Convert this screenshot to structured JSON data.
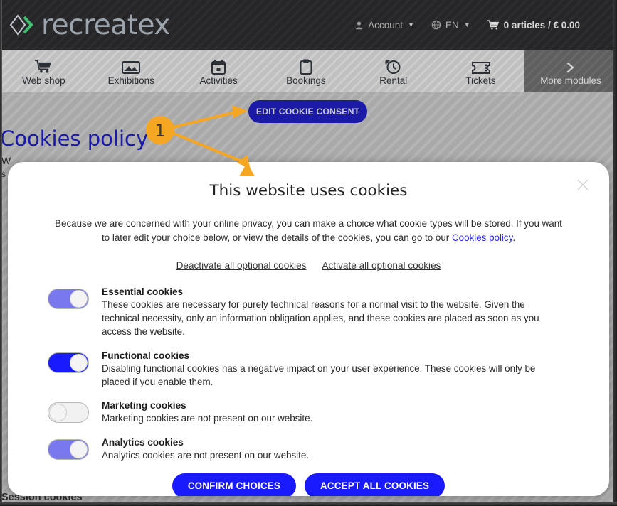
{
  "header": {
    "logo_text": "recreatex",
    "account_label": "Account",
    "language_label": "EN",
    "cart_label": "0 articles / € 0.00"
  },
  "nav": {
    "items": [
      {
        "label": "Web shop",
        "icon": "shopping-cart-icon"
      },
      {
        "label": "Exhibitions",
        "icon": "picture-icon"
      },
      {
        "label": "Activities",
        "icon": "calendar-icon"
      },
      {
        "label": "Bookings",
        "icon": "clipboard-icon"
      },
      {
        "label": "Rental",
        "icon": "clock-rewind-icon"
      },
      {
        "label": "Tickets",
        "icon": "ticket-icon"
      }
    ],
    "more_label": "More modules",
    "more_icon": "chevron-right-icon"
  },
  "page": {
    "title": "Cookies policy",
    "edit_consent_label": "EDIT COOKIE CONSENT",
    "behind_line_1": "W",
    "behind_line_2": "s",
    "behind_line_3": "Session cookies"
  },
  "annotation": {
    "step_number": "1",
    "color": "#f5a623"
  },
  "modal": {
    "title": "This website uses cookies",
    "intro_part_1": "Because we are concerned with your online privacy, you can make a choice what cookie types will be stored. If you want to later edit your choice below, or view the details of the cookies, you can go to our ",
    "intro_link": "Cookies policy",
    "intro_part_2": ".",
    "deactivate_all_label": "Deactivate all optional cookies",
    "activate_all_label": "Activate all optional cookies",
    "close_icon": "close-icon",
    "categories": [
      {
        "title": "Essential cookies",
        "description": "These cookies are necessary for purely technical reasons for a normal visit to the website. Given the technical necessity, only an information obligation applies, and these cookies are placed as soon as you access the website.",
        "state": "on-muted"
      },
      {
        "title": "Functional cookies",
        "description": "Disabling functional cookies has a negative impact on your user experience. These cookies will only be placed if you enable them.",
        "state": "on"
      },
      {
        "title": "Marketing cookies",
        "description": "Marketing cookies are not present on our website.",
        "state": "off"
      },
      {
        "title": "Analytics cookies",
        "description": "Analytics cookies are not present on our website.",
        "state": "on-muted"
      }
    ],
    "confirm_label": "CONFIRM CHOICES",
    "accept_all_label": "ACCEPT ALL COOKIES"
  },
  "colors": {
    "brand_blue": "#1a1aff",
    "dark_blue": "#1a1aa6",
    "annotation_orange": "#f5a623",
    "link_blue": "#2a2ae0",
    "header_dark": "#262628",
    "page_gray": "#a9a9a9"
  }
}
